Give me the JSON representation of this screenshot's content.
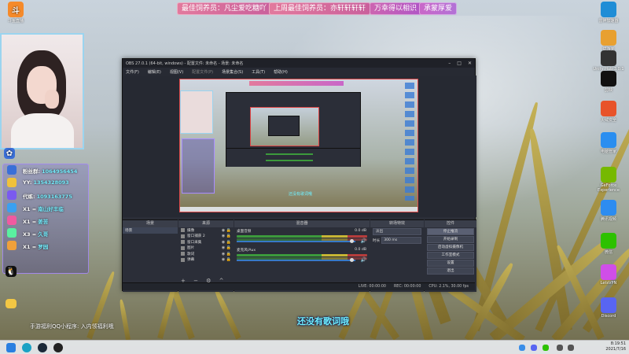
{
  "banners": [
    "最佳饲养员：凡尘爱吃糖吖",
    "上周最佳饲养员：亦轩轩轩轩",
    "万幸得以相识",
    "承蒙厚爱"
  ],
  "desktop_left": [
    {
      "label": "斗鱼直播",
      "icon": "douyu-icon",
      "color": "#f58a2a"
    }
  ],
  "desktop_right": [
    {
      "label": "雷神加速器",
      "icon": "leishen-icon",
      "color": "#1f8dd6"
    },
    {
      "label": "优游天",
      "icon": "youyou-icon",
      "color": "#e8a030"
    },
    {
      "label": "Unity Hub 3.0.1",
      "icon": "unity-icon",
      "color": "#333333"
    },
    {
      "label": "剪映",
      "icon": "capcut-icon",
      "color": "#111111"
    },
    {
      "label": "火绒安全",
      "icon": "huorong-icon",
      "color": "#e8532a"
    },
    {
      "label": "电脑管家",
      "icon": "guanjia-icon",
      "color": "#2a8ef0"
    },
    {
      "label": "GeForce Experience",
      "icon": "nvidia-icon",
      "color": "#76b900"
    },
    {
      "label": "腾讯视频",
      "icon": "tencentvideo-icon",
      "color": "#2d8cf0"
    },
    {
      "label": "微信",
      "icon": "wechat-icon",
      "color": "#2dc100"
    },
    {
      "label": "LetsVPN",
      "icon": "letsvpn-icon",
      "color": "#d04ee8"
    },
    {
      "label": "Discord",
      "icon": "discord-icon",
      "color": "#5865f2"
    }
  ],
  "chat": {
    "lines": [
      {
        "label": "粉丝群:",
        "value": "1064956454"
      },
      {
        "label": "YY:",
        "value": "1354328093"
      },
      {
        "label": "代练:",
        "value": "1093163775"
      },
      {
        "label": "X1 =",
        "value": "南山好丰临"
      },
      {
        "label": "X1 =",
        "value": "姜苦"
      },
      {
        "label": "X3 =",
        "value": "久哥"
      },
      {
        "label": "X1 =",
        "value": "罗园"
      }
    ],
    "ticker": "手游福利QQ小程序: 入内领福利哦"
  },
  "obs": {
    "title": "OBS 27.0.1 (64-bit, windows) - 配置文件: 未命名 - 场景: 未命名",
    "menu": [
      "文件(F)",
      "编辑(E)",
      "视图(V)",
      "配置文件(P)",
      "场景集合(S)",
      "工具(T)",
      "帮助(H)"
    ],
    "scene_panel_title": "场景",
    "scenes": [
      "场景"
    ],
    "sources_panel_title": "来源",
    "sources": [
      "摄像",
      "窗口捕获 2",
      "窗口采集",
      "图片",
      "歌词",
      "弹幕"
    ],
    "mixer_title": "混音器",
    "mixer": [
      {
        "name": "桌面音频",
        "db": "0.0 dB"
      },
      {
        "name": "麦克风/Aux",
        "db": "0.0 dB"
      }
    ],
    "transition_title": "转场特效",
    "transition_value": "淡出",
    "duration_label": "时长",
    "duration_value": "300 ms",
    "controls_title": "控件",
    "controls": [
      "停止推流",
      "开始录制",
      "启动虚拟摄像机",
      "工作室模式",
      "设置",
      "退出"
    ],
    "status": {
      "live": "LIVE: 00:00:00",
      "rec": "REC: 00:00:00",
      "cpu": "CPU: 2.1%, 30.00 fps"
    }
  },
  "lyric": "还没有歌词哦",
  "tray": {
    "time": "8:19:51",
    "date": "2021/7/16"
  }
}
